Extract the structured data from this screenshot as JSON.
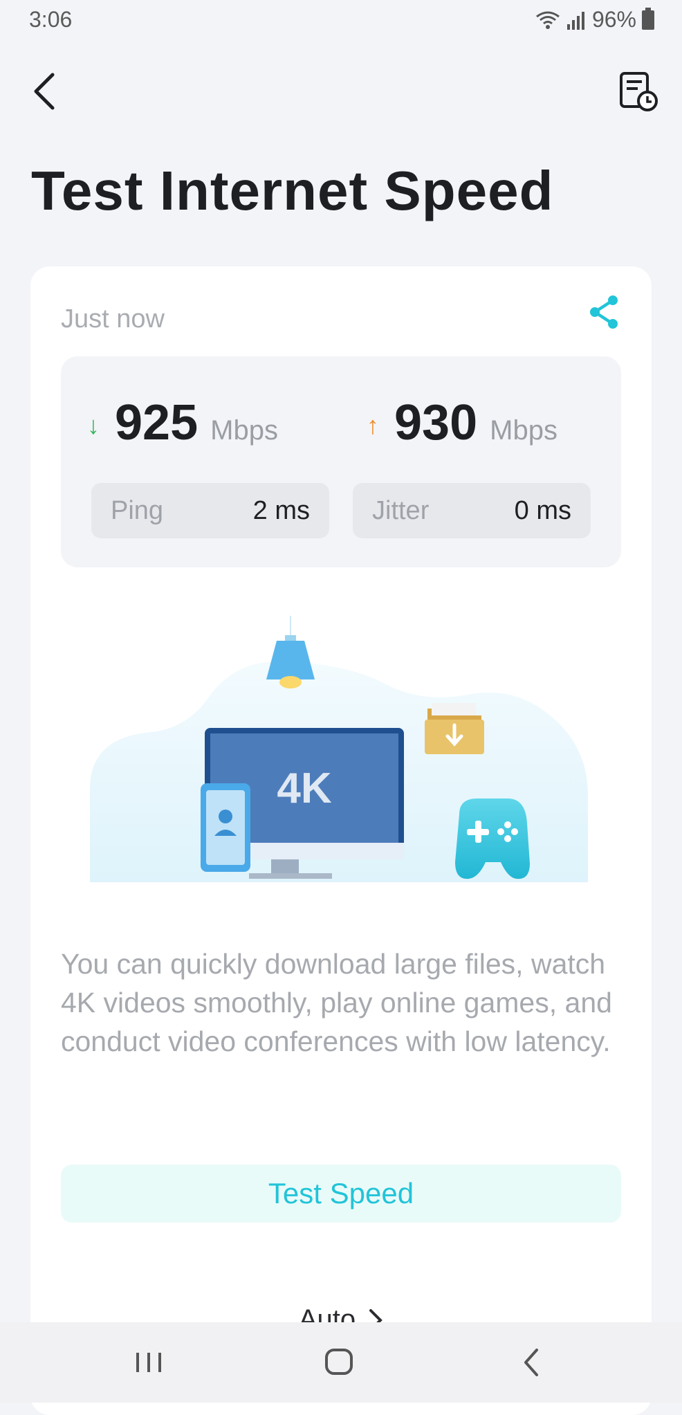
{
  "status_bar": {
    "time": "3:06",
    "battery": "96%",
    "icons": [
      "wifi-icon",
      "signal-icon",
      "battery-icon"
    ]
  },
  "header": {
    "back_icon": "chevron-left-icon",
    "history_icon": "report-history-icon"
  },
  "page": {
    "title": "Test Internet Speed"
  },
  "result_card": {
    "timestamp": "Just now",
    "share_icon": "share-icon",
    "download": {
      "value": "925",
      "unit": "Mbps",
      "icon": "arrow-down-icon",
      "color": "#33b85c"
    },
    "upload": {
      "value": "930",
      "unit": "Mbps",
      "icon": "arrow-up-icon",
      "color": "#ef8d2a"
    },
    "ping": {
      "label": "Ping",
      "value": "2 ms"
    },
    "jitter": {
      "label": "Jitter",
      "value": "0 ms"
    },
    "illustration": {
      "screen_text": "4K"
    },
    "description": "You can quickly download large files, watch 4K videos smoothly, play online games, and conduct video conferences with low latency.",
    "test_button_label": "Test Speed",
    "mode_label": "Auto"
  },
  "colors": {
    "accent": "#22c4d8",
    "background": "#f3f4f8"
  },
  "nav_bar": {
    "icons": [
      "recent-apps-icon",
      "home-icon",
      "back-icon"
    ]
  }
}
